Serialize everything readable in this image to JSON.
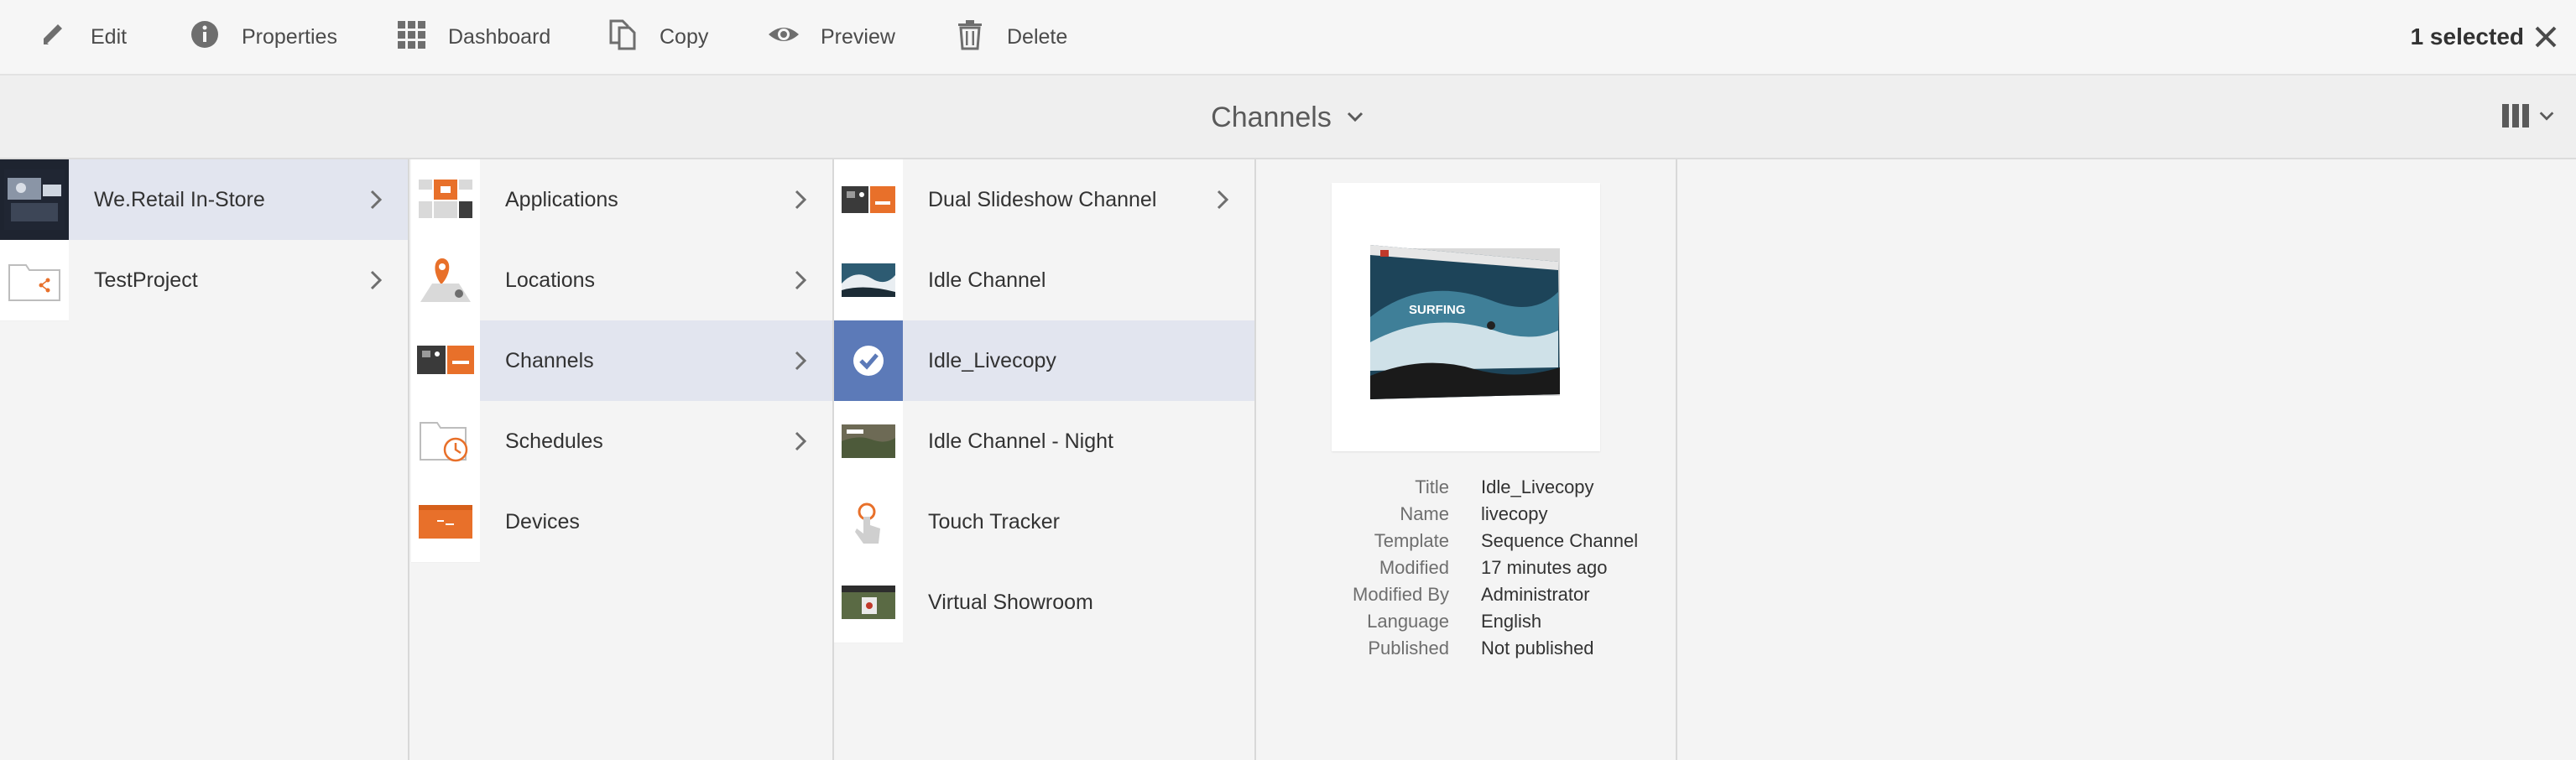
{
  "actionbar": {
    "actions": [
      {
        "label": "Edit",
        "icon": "pencil-icon"
      },
      {
        "label": "Properties",
        "icon": "info-icon"
      },
      {
        "label": "Dashboard",
        "icon": "grid-icon"
      },
      {
        "label": "Copy",
        "icon": "copy-icon"
      },
      {
        "label": "Preview",
        "icon": "eye-icon"
      },
      {
        "label": "Delete",
        "icon": "trash-icon"
      }
    ],
    "selected_text": "1 selected",
    "close_icon": "close-icon"
  },
  "titlebar": {
    "title": "Channels",
    "view_icon": "column-view-icon"
  },
  "columns": {
    "projects": [
      {
        "label": "We.Retail In-Store",
        "active": true,
        "has_children": true
      },
      {
        "label": "TestProject",
        "active": false,
        "has_children": true
      }
    ],
    "sections": [
      {
        "label": "Applications",
        "icon": "applications-icon",
        "has_children": true
      },
      {
        "label": "Locations",
        "icon": "locations-icon",
        "has_children": true
      },
      {
        "label": "Channels",
        "icon": "channels-icon",
        "active": true,
        "has_children": true
      },
      {
        "label": "Schedules",
        "icon": "schedules-icon",
        "has_children": true
      },
      {
        "label": "Devices",
        "icon": "devices-icon",
        "has_children": false
      }
    ],
    "channels": [
      {
        "label": "Dual Slideshow Channel",
        "has_children": true
      },
      {
        "label": "Idle Channel"
      },
      {
        "label": "Idle_Livecopy",
        "selected": true
      },
      {
        "label": "Idle Channel - Night"
      },
      {
        "label": "Touch Tracker"
      },
      {
        "label": "Virtual Showroom"
      }
    ]
  },
  "preview": {
    "thumbnail_text": "SURFING",
    "meta": [
      {
        "key": "Title",
        "value": "Idle_Livecopy"
      },
      {
        "key": "Name",
        "value": "livecopy"
      },
      {
        "key": "Template",
        "value": "Sequence Channel"
      },
      {
        "key": "Modified",
        "value": "17 minutes ago"
      },
      {
        "key": "Modified By",
        "value": "Administrator"
      },
      {
        "key": "Language",
        "value": "English"
      },
      {
        "key": "Published",
        "value": "Not published"
      }
    ]
  },
  "colors": {
    "accent": "#e8702a",
    "selected_row": "#e2e5ef",
    "check_overlay": "#5c7ab8"
  }
}
